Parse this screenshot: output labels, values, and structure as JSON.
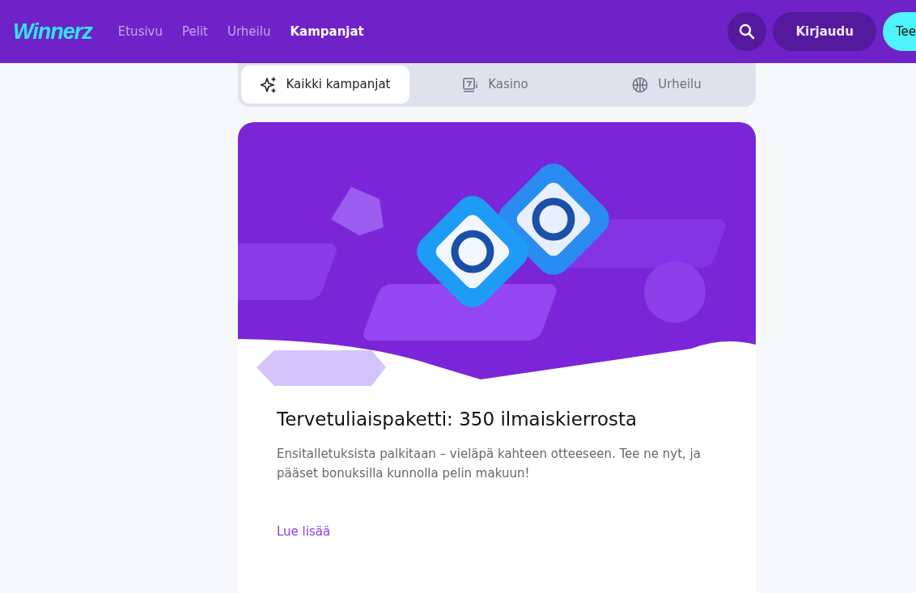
{
  "header": {
    "logo": "Winnerz",
    "nav": [
      {
        "label": "Etusivu",
        "selected": false
      },
      {
        "label": "Pelit",
        "selected": false
      },
      {
        "label": "Urheilu",
        "selected": false
      },
      {
        "label": "Kampanjat",
        "selected": true
      }
    ],
    "login": "Kirjaudu",
    "register": "Tee"
  },
  "filter_tabs": [
    {
      "label": "Kaikki kampanjat",
      "kind": "sparkle",
      "selected": true
    },
    {
      "label": "Kasino",
      "kind": "slot",
      "selected": false
    },
    {
      "label": "Urheilu",
      "kind": "ball",
      "selected": false
    }
  ],
  "promo": {
    "title": "Tervetuliaispaketti: 350 ilmaiskierrosta",
    "text": "Ensitalletuksista palkitaan – vieläpä kahteen otteeseen. Tee ne nyt, ja pääset bonuksilla kunnolla pelin makuun!",
    "link": "Lue lisää"
  }
}
